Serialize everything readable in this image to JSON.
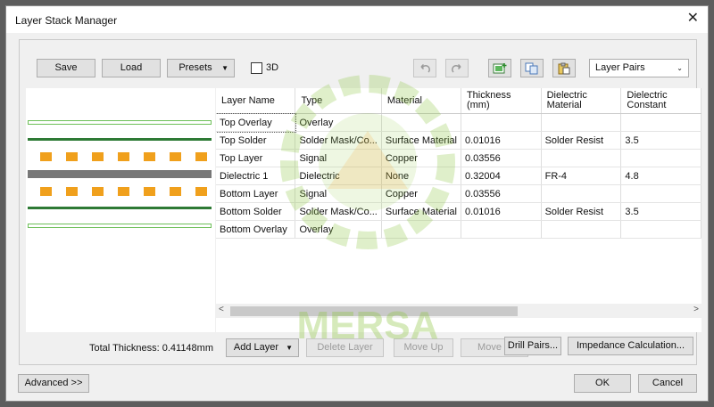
{
  "window": {
    "title": "Layer Stack Manager",
    "close_glyph": "✕"
  },
  "toolbar": {
    "save": "Save",
    "load": "Load",
    "presets": "Presets",
    "check_3d": "3D",
    "layer_pairs": "Layer Pairs"
  },
  "table": {
    "columns": [
      "Layer Name",
      "Type",
      "Material",
      "Thickness (mm)",
      "Dielectric Material",
      "Dielectric Constant"
    ],
    "rows": [
      [
        "Top Overlay",
        "Overlay",
        "",
        "",
        "",
        ""
      ],
      [
        "Top Solder",
        "Solder Mask/Co...",
        "Surface Material",
        "0.01016",
        "Solder Resist",
        "3.5"
      ],
      [
        "Top Layer",
        "Signal",
        "Copper",
        "0.03556",
        "",
        ""
      ],
      [
        "Dielectric 1",
        "Dielectric",
        "None",
        "0.32004",
        "FR-4",
        "4.8"
      ],
      [
        "Bottom Layer",
        "Signal",
        "Copper",
        "0.03556",
        "",
        ""
      ],
      [
        "Bottom Solder",
        "Solder Mask/Co...",
        "Surface Material",
        "0.01016",
        "Solder Resist",
        "3.5"
      ],
      [
        "Bottom Overlay",
        "Overlay",
        "",
        "",
        "",
        ""
      ]
    ]
  },
  "bottom": {
    "total_thickness": "Total Thickness: 0.41148mm",
    "add_layer": "Add Layer",
    "delete_layer": "Delete Layer",
    "move_up": "Move Up",
    "move_down": "Move D",
    "drill_pairs": "Drill Pairs...",
    "impedance": "Impedance Calculation..."
  },
  "footer": {
    "advanced": "Advanced >>",
    "ok": "OK",
    "cancel": "Cancel"
  },
  "watermark": {
    "text": "MERSA"
  },
  "colors": {
    "overlay": "#6dbf58",
    "solder": "#2e7a35",
    "copper": "#f0a01c",
    "dielectric": "#777777",
    "watermark": "#8dc63f"
  }
}
